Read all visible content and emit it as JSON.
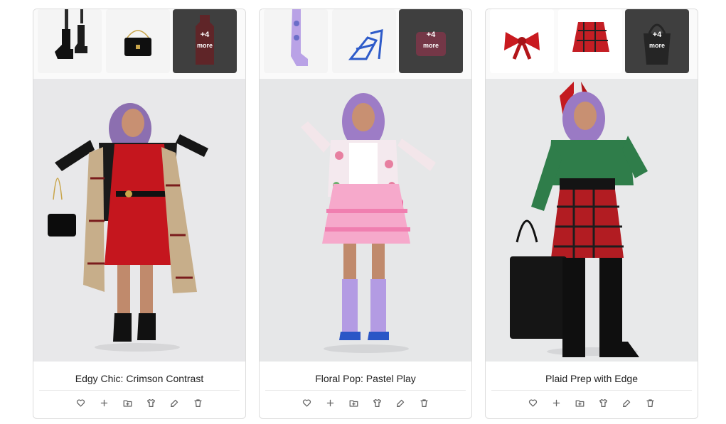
{
  "outfits": [
    {
      "title": "Edgy Chic: Crimson Contrast",
      "extra_items": "+4",
      "more_word": "more",
      "items": [
        "black-platform-boots",
        "black-quilted-chain-bag"
      ],
      "more_preview": "red-knit-dress",
      "colors": {
        "top": "#d1202a",
        "accent": "#1a1a1a",
        "scarf": "#c9b08f"
      }
    },
    {
      "title": "Floral Pop: Pastel Play",
      "extra_items": "+4",
      "more_word": "more",
      "items": [
        "lavender-knee-socks",
        "blue-strappy-heels"
      ],
      "more_preview": "pink-quilted-bag",
      "colors": {
        "top": "#ffffff",
        "accent": "#f48ab8",
        "scarf": "#b9a3e8"
      }
    },
    {
      "title": "Plaid Prep with Edge",
      "extra_items": "+4",
      "more_word": "more",
      "items": [
        "red-hair-bow",
        "red-plaid-skirt"
      ],
      "more_preview": "black-tote-bag",
      "colors": {
        "top": "#2f7d4a",
        "accent": "#b01c22",
        "scarf": "#111111"
      }
    }
  ],
  "actions": [
    "heart-icon",
    "plus-icon",
    "folder-plus-icon",
    "shirt-icon",
    "edit-icon",
    "trash-icon"
  ]
}
